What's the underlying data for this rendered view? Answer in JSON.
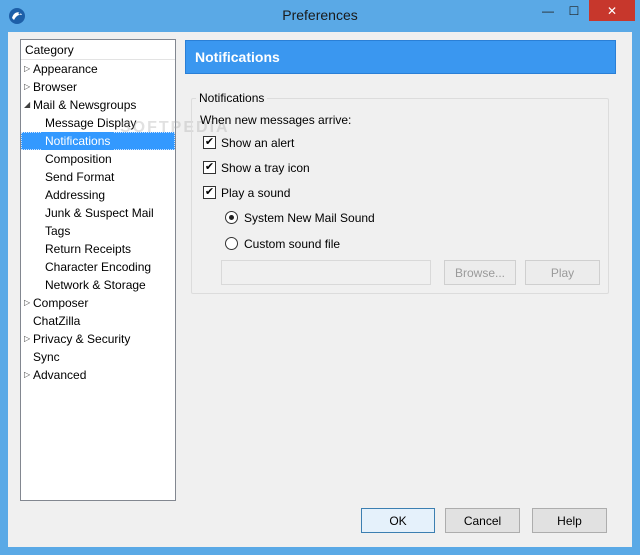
{
  "window": {
    "title": "Preferences",
    "minimize_glyph": "—",
    "maximize_glyph": "☐",
    "close_glyph": "✕"
  },
  "category": {
    "header": "Category",
    "items": [
      {
        "label": "Appearance",
        "level": 0,
        "twisty": "▷"
      },
      {
        "label": "Browser",
        "level": 0,
        "twisty": "▷"
      },
      {
        "label": "Mail & Newsgroups",
        "level": 0,
        "twisty": "◢"
      },
      {
        "label": "Message Display",
        "level": 1,
        "twisty": ""
      },
      {
        "label": "Notifications",
        "level": 1,
        "twisty": "",
        "selected": true
      },
      {
        "label": "Composition",
        "level": 1,
        "twisty": ""
      },
      {
        "label": "Send Format",
        "level": 1,
        "twisty": ""
      },
      {
        "label": "Addressing",
        "level": 1,
        "twisty": ""
      },
      {
        "label": "Junk & Suspect Mail",
        "level": 1,
        "twisty": ""
      },
      {
        "label": "Tags",
        "level": 1,
        "twisty": ""
      },
      {
        "label": "Return Receipts",
        "level": 1,
        "twisty": ""
      },
      {
        "label": "Character Encoding",
        "level": 1,
        "twisty": ""
      },
      {
        "label": "Network & Storage",
        "level": 1,
        "twisty": ""
      },
      {
        "label": "Composer",
        "level": 0,
        "twisty": "▷"
      },
      {
        "label": "ChatZilla",
        "level": 0,
        "twisty": ""
      },
      {
        "label": "Privacy & Security",
        "level": 0,
        "twisty": "▷"
      },
      {
        "label": "Sync",
        "level": 0,
        "twisty": ""
      },
      {
        "label": "Advanced",
        "level": 0,
        "twisty": "▷"
      }
    ]
  },
  "pane": {
    "title": "Notifications",
    "group_caption": "Notifications",
    "intro": "When new messages arrive:",
    "show_alert": {
      "label": "Show an alert",
      "checked": true
    },
    "show_tray": {
      "label": "Show a tray icon",
      "checked": true
    },
    "play_sound": {
      "label": "Play a sound",
      "checked": true
    },
    "sound_system": {
      "label": "System New Mail Sound",
      "selected": true
    },
    "sound_custom": {
      "label": "Custom sound file",
      "selected": false
    },
    "sound_file_value": "",
    "browse_label": "Browse...",
    "play_label": "Play",
    "check_glyph": "✔"
  },
  "footer": {
    "ok_label": "OK",
    "cancel_label": "Cancel",
    "help_label": "Help"
  },
  "colors": {
    "title_bar": "#5aa9e6",
    "header_blue": "#3a97f0",
    "selection": "#3399ff",
    "close_red": "#c7372c"
  }
}
